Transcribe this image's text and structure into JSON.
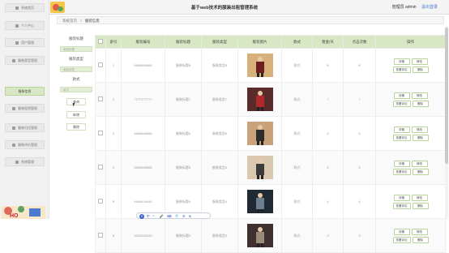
{
  "header": {
    "title": "基于web技术的服装出租管理系统",
    "user_label": "管理员 admin",
    "logout_label": "退出登录"
  },
  "sidebar": {
    "items": [
      {
        "label": "系统首页",
        "icon": "home-icon"
      },
      {
        "label": "个人中心",
        "icon": "user-icon"
      },
      {
        "label": "用户管理",
        "icon": "users-icon"
      },
      {
        "label": "服装类型管理",
        "icon": "tag-icon"
      },
      {
        "label": "服装信息",
        "icon": "shirt-icon",
        "active": true
      },
      {
        "label": "服装租赁管理",
        "icon": "cart-icon"
      },
      {
        "label": "服装归还管理",
        "icon": "return-icon"
      },
      {
        "label": "服装评价管理",
        "icon": "comment-icon"
      },
      {
        "label": "系统管理",
        "icon": "settings-icon"
      }
    ]
  },
  "breadcrumb": {
    "home": "系统首页",
    "sep": "/",
    "current": "服装信息"
  },
  "search": {
    "name_label": "服装标题",
    "name_placeholder": "服装标题",
    "type_label": "服装类型",
    "type_placeholder": "服装类型",
    "style_label": "款式",
    "style_placeholder": "款式",
    "search_btn": "查询",
    "add_btn": "新增",
    "delete_btn": "删除"
  },
  "table": {
    "headers": [
      "",
      "索引",
      "服装编号",
      "服装标题",
      "服装类型",
      "服装图片",
      "款式",
      "租金/天",
      "点击次数",
      "操作"
    ],
    "rows": [
      {
        "index": "1",
        "code": "6666666666",
        "title": "服装标题8",
        "type": "服装类型8",
        "style": "款式",
        "rent": "8",
        "clicks": "8"
      },
      {
        "index": "2",
        "code": "7777777777",
        "title": "服装标题7",
        "type": "服装类型7",
        "style": "款式",
        "rent": "7",
        "clicks": "7"
      },
      {
        "index": "3",
        "code": "6666666666",
        "title": "服装标题6",
        "type": "服装类型6",
        "style": "款式",
        "rent": "6",
        "clicks": "6"
      },
      {
        "index": "4",
        "code": "5555555555",
        "title": "服装标题5",
        "type": "服装类型5",
        "style": "款式",
        "rent": "5",
        "clicks": "5"
      },
      {
        "index": "5",
        "code": "4444444444",
        "title": "服装标题4",
        "type": "服装类型4",
        "style": "款式",
        "rent": "4",
        "clicks": "4"
      },
      {
        "index": "6",
        "code": "3333333333",
        "title": "服装标题3",
        "type": "服装类型3",
        "style": "款式",
        "rent": "3",
        "clicks": "3"
      }
    ],
    "actions": {
      "detail": "详情",
      "edit": "修改",
      "review": "查看评论",
      "delete": "删除"
    }
  },
  "float_toolbar": {
    "text": "中 º, 🎤 ⌨ 👕 ⚙ ⊞"
  },
  "colors": {
    "accent": "#d9e8c4",
    "accent_border": "#b9d39c",
    "link": "#4a7bd0"
  }
}
